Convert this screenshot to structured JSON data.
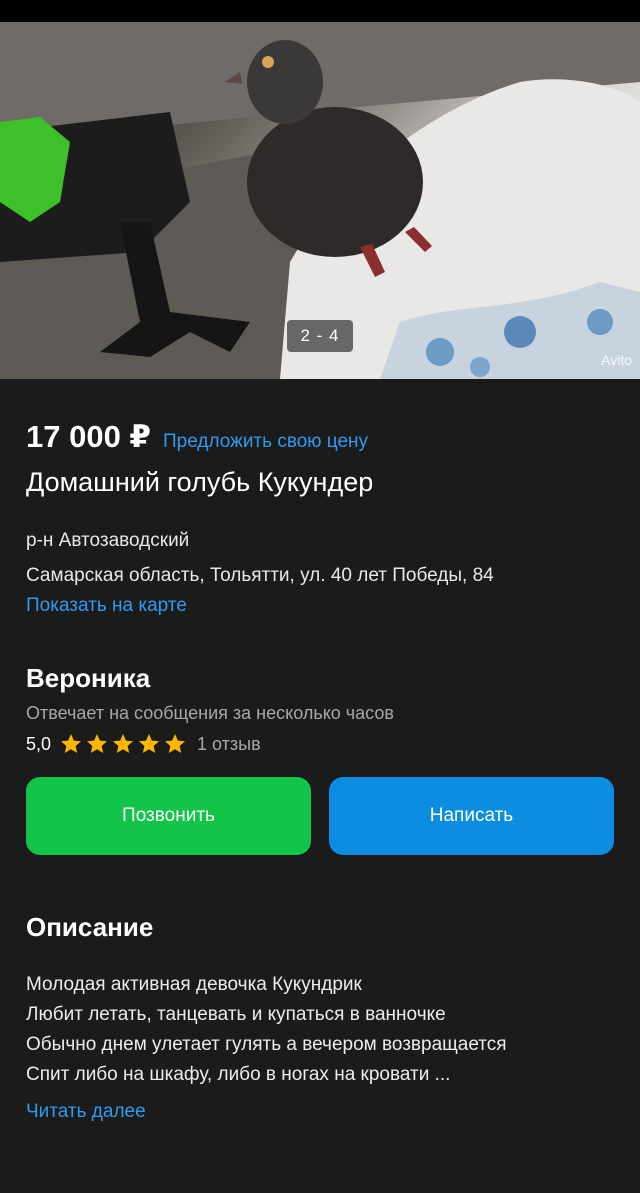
{
  "gallery": {
    "counter": "2 - 4",
    "watermark": "Avito"
  },
  "listing": {
    "price": "17 000 ₽",
    "offer_link": "Предложить свою цену",
    "title": "Домашний голубь Кукундер",
    "district": "р-н Автозаводский",
    "address": "Самарская область, Тольятти, ул. 40 лет Победы, 84",
    "map_link": "Показать на карте"
  },
  "seller": {
    "name": "Вероника",
    "reply_time": "Отвечает на сообщения за несколько часов",
    "rating": "5,0",
    "stars": 5,
    "reviews": "1 отзыв"
  },
  "actions": {
    "call_label": "Позвонить",
    "write_label": "Написать"
  },
  "description": {
    "heading": "Описание",
    "lines": [
      "Молодая активная девочка Кукундрик",
      "Любит летать, танцевать и купаться в ванночке",
      "Обычно днем улетает гулять а вечером возвращается",
      "Спит либо на шкафу, либо в ногах на кровати ..."
    ],
    "read_more": "Читать далее"
  },
  "colors": {
    "background": "#1b1b1b",
    "link": "#2e9bf0",
    "call_button": "#12c449",
    "write_button": "#0c8de0",
    "star": "#ffb800"
  }
}
